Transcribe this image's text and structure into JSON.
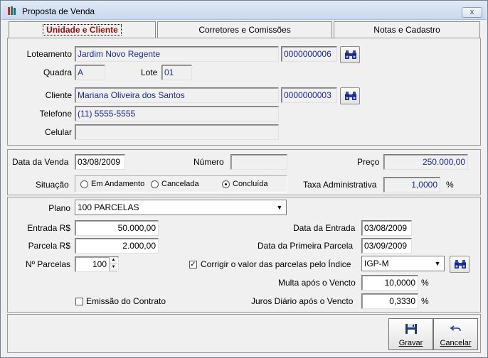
{
  "window": {
    "title": "Proposta de Venda",
    "close_glyph": "x"
  },
  "tabs": [
    {
      "label": "Unidade e Cliente",
      "active": true
    },
    {
      "label": "Corretores e Comissões",
      "active": false
    },
    {
      "label": "Notas e Cadastro",
      "active": false
    }
  ],
  "unidade": {
    "loteamento_label": "Loteamento",
    "loteamento_value": "Jardim Novo Regente",
    "loteamento_code": "0000000006",
    "quadra_label": "Quadra",
    "quadra_value": "A",
    "lote_label": "Lote",
    "lote_value": "01",
    "cliente_label": "Cliente",
    "cliente_value": "Mariana Oliveira dos Santos",
    "cliente_code": "0000000003",
    "telefone_label": "Telefone",
    "telefone_value": "(11) 5555-5555",
    "celular_label": "Celular",
    "celular_value": ""
  },
  "venda": {
    "data_label": "Data da Venda",
    "data_value": "03/08/2009",
    "numero_label": "Número",
    "numero_value": "",
    "preco_label": "Preço",
    "preco_value": "250.000,00",
    "situacao_label": "Situação",
    "situacao_options": [
      "Em Andamento",
      "Cancelada",
      "Concluída"
    ],
    "situacao_selected": "Concluída",
    "taxa_label": "Taxa Administrativa",
    "taxa_value": "1,0000",
    "taxa_unit": "%"
  },
  "plano": {
    "plano_label": "Plano",
    "plano_value": "100 PARCELAS",
    "entrada_label": "Entrada R$",
    "entrada_value": "50.000,00",
    "parcela_label": "Parcela R$",
    "parcela_value": "2.000,00",
    "nparcelas_label": "Nº Parcelas",
    "nparcelas_value": "100",
    "data_entrada_label": "Data da Entrada",
    "data_entrada_value": "03/08/2009",
    "data_primeira_label": "Data da Primeira Parcela",
    "data_primeira_value": "03/09/2009",
    "corrigir_label": "Corrigir o valor das parcelas pelo Índice",
    "corrigir_checked": true,
    "indice_value": "IGP-M",
    "multa_label": "Multa após o Vencto",
    "multa_value": "10,0000",
    "multa_unit": "%",
    "juros_label": "Juros Diário após o Vencto",
    "juros_value": "0,3330",
    "juros_unit": "%",
    "emissao_label": "Emissão do Contrato",
    "emissao_checked": false
  },
  "buttons": {
    "gravar": "Gravar",
    "cancelar": "Cancelar"
  },
  "icons": {
    "search": "binoculars-icon",
    "save": "floppy-disk-icon",
    "cancel": "undo-arrow-icon"
  }
}
